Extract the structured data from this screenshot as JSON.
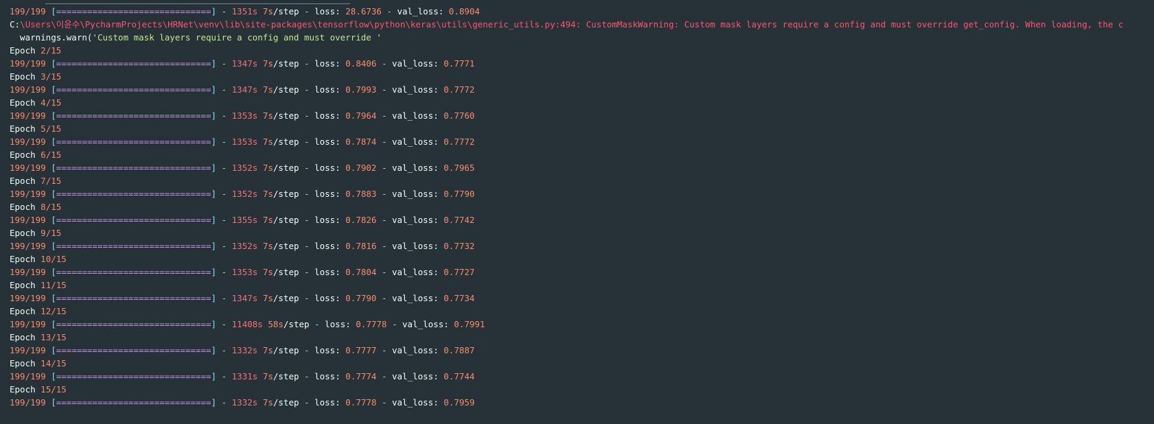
{
  "top_line": {
    "counter": "199/199",
    "bar": "==============================",
    "time": "1351s",
    "rate": "7s",
    "loss": "28.6736",
    "val_loss": "0.8904"
  },
  "labels": {
    "step": "/step",
    "loss": "loss:",
    "val_loss": "val_loss:",
    "epoch": "Epoch"
  },
  "warning": {
    "drive": "C:",
    "path": "\\Users\\이윤수\\PycharmProjects\\HRNet\\venv\\lib\\site-packages\\tensorflow\\python\\keras\\utils\\generic_utils.py:494: CustomMaskWarning: Custom mask layers require a config and must override get_config. When loading, the c",
    "call_fn": "  warnings.warn(",
    "call_str": "'Custom mask layers require a config and must override '"
  },
  "epochs": [
    {
      "epoch": "2/15",
      "counter": "199/199",
      "bar": "==============================",
      "time": "1347s",
      "rate": "7s",
      "loss": "0.8406",
      "val_loss": "0.7771"
    },
    {
      "epoch": "3/15",
      "counter": "199/199",
      "bar": "==============================",
      "time": "1347s",
      "rate": "7s",
      "loss": "0.7993",
      "val_loss": "0.7772"
    },
    {
      "epoch": "4/15",
      "counter": "199/199",
      "bar": "==============================",
      "time": "1353s",
      "rate": "7s",
      "loss": "0.7964",
      "val_loss": "0.7760"
    },
    {
      "epoch": "5/15",
      "counter": "199/199",
      "bar": "==============================",
      "time": "1353s",
      "rate": "7s",
      "loss": "0.7874",
      "val_loss": "0.7772"
    },
    {
      "epoch": "6/15",
      "counter": "199/199",
      "bar": "==============================",
      "time": "1352s",
      "rate": "7s",
      "loss": "0.7902",
      "val_loss": "0.7965"
    },
    {
      "epoch": "7/15",
      "counter": "199/199",
      "bar": "==============================",
      "time": "1352s",
      "rate": "7s",
      "loss": "0.7883",
      "val_loss": "0.7790"
    },
    {
      "epoch": "8/15",
      "counter": "199/199",
      "bar": "==============================",
      "time": "1355s",
      "rate": "7s",
      "loss": "0.7826",
      "val_loss": "0.7742"
    },
    {
      "epoch": "9/15",
      "counter": "199/199",
      "bar": "==============================",
      "time": "1352s",
      "rate": "7s",
      "loss": "0.7816",
      "val_loss": "0.7732"
    },
    {
      "epoch": "10/15",
      "counter": "199/199",
      "bar": "==============================",
      "time": "1353s",
      "rate": "7s",
      "loss": "0.7804",
      "val_loss": "0.7727"
    },
    {
      "epoch": "11/15",
      "counter": "199/199",
      "bar": "==============================",
      "time": "1347s",
      "rate": "7s",
      "loss": "0.7790",
      "val_loss": "0.7734"
    },
    {
      "epoch": "12/15",
      "counter": "199/199",
      "bar": "==============================",
      "time": "11408s",
      "rate": "58s",
      "loss": "0.7778",
      "val_loss": "0.7991"
    },
    {
      "epoch": "13/15",
      "counter": "199/199",
      "bar": "==============================",
      "time": "1332s",
      "rate": "7s",
      "loss": "0.7777",
      "val_loss": "0.7887"
    },
    {
      "epoch": "14/15",
      "counter": "199/199",
      "bar": "==============================",
      "time": "1331s",
      "rate": "7s",
      "loss": "0.7774",
      "val_loss": "0.7744"
    },
    {
      "epoch": "15/15",
      "counter": "199/199",
      "bar": "==============================",
      "time": "1332s",
      "rate": "7s",
      "loss": "0.7778",
      "val_loss": "0.7959"
    }
  ]
}
